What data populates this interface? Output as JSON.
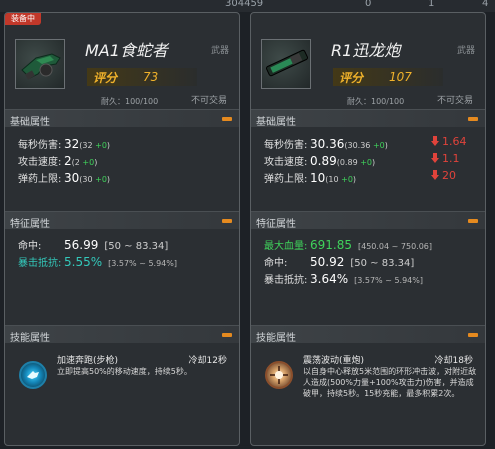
{
  "topbar": {
    "num1": "304459",
    "num2": "0",
    "num3": "1",
    "num4": "4"
  },
  "left": {
    "badge": "装备中",
    "name": "MA1食蛇者",
    "type": "武器",
    "score_label": "评分",
    "score": "73",
    "durability": "耐久：100/100",
    "tradeable": "不可交易",
    "sections": {
      "base": "基础属性",
      "feature": "特征属性",
      "skill": "技能属性"
    },
    "base": [
      {
        "label": "每秒伤害:",
        "main": "32",
        "paren_open": "(32 ",
        "plus": "+0",
        "paren_close": ")"
      },
      {
        "label": "攻击速度:",
        "main": "2",
        "paren_open": "(2 ",
        "plus": "+0",
        "paren_close": ")"
      },
      {
        "label": "弹药上限:",
        "main": "30",
        "paren_open": "(30 ",
        "plus": "+0",
        "paren_close": ")"
      }
    ],
    "feature": [
      {
        "label": "命中:",
        "value": "56.99",
        "range": "[50 ~ 83.34]"
      },
      {
        "label": "暴击抵抗:",
        "value": "5.55%",
        "range": "[3.57% ~ 5.94%]"
      }
    ],
    "skill": {
      "name": "加速奔跑(步枪)",
      "cooldown": "冷却12秒",
      "desc": "立即提高50%的移动速度，持续5秒。",
      "icon": "sprint-skill-icon"
    }
  },
  "right": {
    "name": "R1迅龙炮",
    "type": "武器",
    "score_label": "评分",
    "score": "107",
    "durability": "耐久：100/100",
    "tradeable": "不可交易",
    "sections": {
      "base": "基础属性",
      "feature": "特征属性",
      "skill": "技能属性"
    },
    "base": [
      {
        "label": "每秒伤害:",
        "main": "30.36",
        "paren_open": "(30.36 ",
        "plus": "+0",
        "paren_close": ")",
        "diff": "1.64"
      },
      {
        "label": "攻击速度:",
        "main": "0.89",
        "paren_open": "(0.89 ",
        "plus": "+0",
        "paren_close": ")",
        "diff": "1.1"
      },
      {
        "label": "弹药上限:",
        "main": "10",
        "paren_open": "(10 ",
        "plus": "+0",
        "paren_close": ")",
        "diff": "20"
      }
    ],
    "feature": [
      {
        "label": "最大血量:",
        "value": "691.85",
        "range": "[450.04 ~ 750.06]"
      },
      {
        "label": "命中:",
        "value": "50.92",
        "range": "[50 ~ 83.34]"
      },
      {
        "label": "暴击抵抗:",
        "value": "3.64%",
        "range": "[3.57% ~ 5.94%]"
      }
    ],
    "skill": {
      "name": "震荡波动(重炮)",
      "cooldown": "冷却18秒",
      "desc": "以自身中心释放5米范围的环形冲击波，对附近敌人造成(500%力量+100%攻击力)伤害，并造成破甲，持续5秒。15秒充能，最多积累2次。",
      "icon": "shockwave-skill-icon"
    }
  },
  "colors": {
    "accent": "#f0b22b",
    "green": "#3fd25b",
    "cyan": "#33c9bb",
    "down_red": "#e0433b",
    "badge_red": "#c2382a",
    "collapse_orange": "#e58a1f"
  }
}
